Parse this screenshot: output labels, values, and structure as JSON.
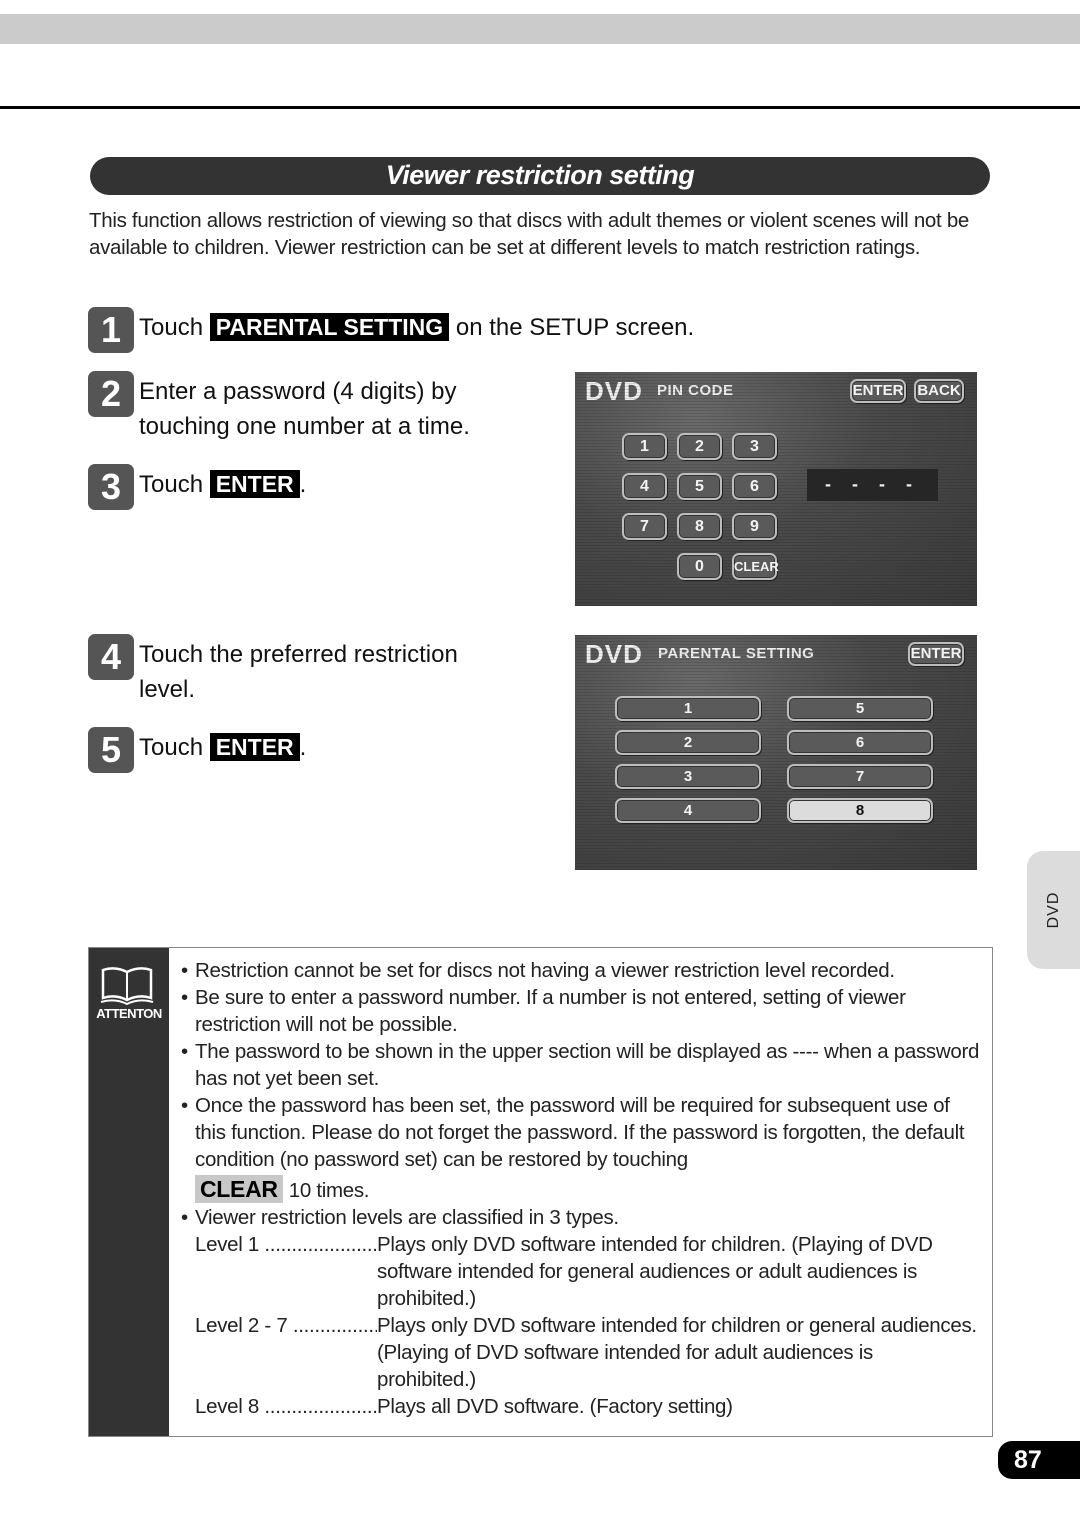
{
  "section_title": "Viewer restriction setting",
  "intro": "This function allows restriction of viewing so that discs with adult themes or violent scenes will not be available to children.  Viewer restriction can be set at different levels to match restriction ratings.",
  "steps": [
    {
      "num": "1",
      "pre": "Touch ",
      "key": "PARENTAL SETTING",
      "post": " on the SETUP screen."
    },
    {
      "num": "2",
      "line1": "Enter a password (4 digits) by",
      "line2": "touching one number at a time."
    },
    {
      "num": "3",
      "pre": "Touch ",
      "key": "ENTER",
      "post": "."
    },
    {
      "num": "4",
      "line1": "Touch the preferred restriction",
      "line2": "level."
    },
    {
      "num": "5",
      "pre": "Touch ",
      "key": "ENTER",
      "post": "."
    }
  ],
  "pin_screen": {
    "logo": "DVD",
    "title": "PIN CODE",
    "enter": "ENTER",
    "back": "BACK",
    "keys": [
      "1",
      "2",
      "3",
      "4",
      "5",
      "6",
      "7",
      "8",
      "9",
      "0",
      "CLEAR"
    ],
    "display": "- - - -"
  },
  "parental_screen": {
    "logo": "DVD",
    "title": "PARENTAL SETTING",
    "enter": "ENTER",
    "levels": [
      "1",
      "2",
      "3",
      "4",
      "5",
      "6",
      "7",
      "8"
    ],
    "selected_level": "8"
  },
  "attention": {
    "label": "ATTENTON",
    "bullets": [
      "Restriction cannot be set for discs not having a viewer restriction level recorded.",
      "Be sure to enter a password number.  If a number is not entered, setting of viewer restriction will not be possible.",
      "The password to be shown in the upper section will be displayed as ---- when a password has not yet been set.",
      "Once the password has been set, the password will be required for subsequent use of this function.  Please do not forget the password.  If the password is forgotten, the default condition (no password set) can be restored by touching"
    ],
    "clear_key": "CLEAR",
    "clear_suffix": "10 times.",
    "levels_intro": "Viewer restriction levels are classified in 3 types.",
    "levels": [
      {
        "name": "Level 1 ..................................",
        "desc": "Plays only DVD software intended for children.  (Playing of DVD software intended for general audiences or adult audiences is prohibited.)"
      },
      {
        "name": "Level 2 - 7 ..............................",
        "desc": "Plays only DVD software intended for children or general audiences.  (Playing of DVD software intended for adult audiences is prohibited.)"
      },
      {
        "name": "Level 8 ..................................",
        "desc": "Plays all DVD software.  (Factory setting)"
      }
    ]
  },
  "side_tab": "DVD",
  "page_number": "87"
}
